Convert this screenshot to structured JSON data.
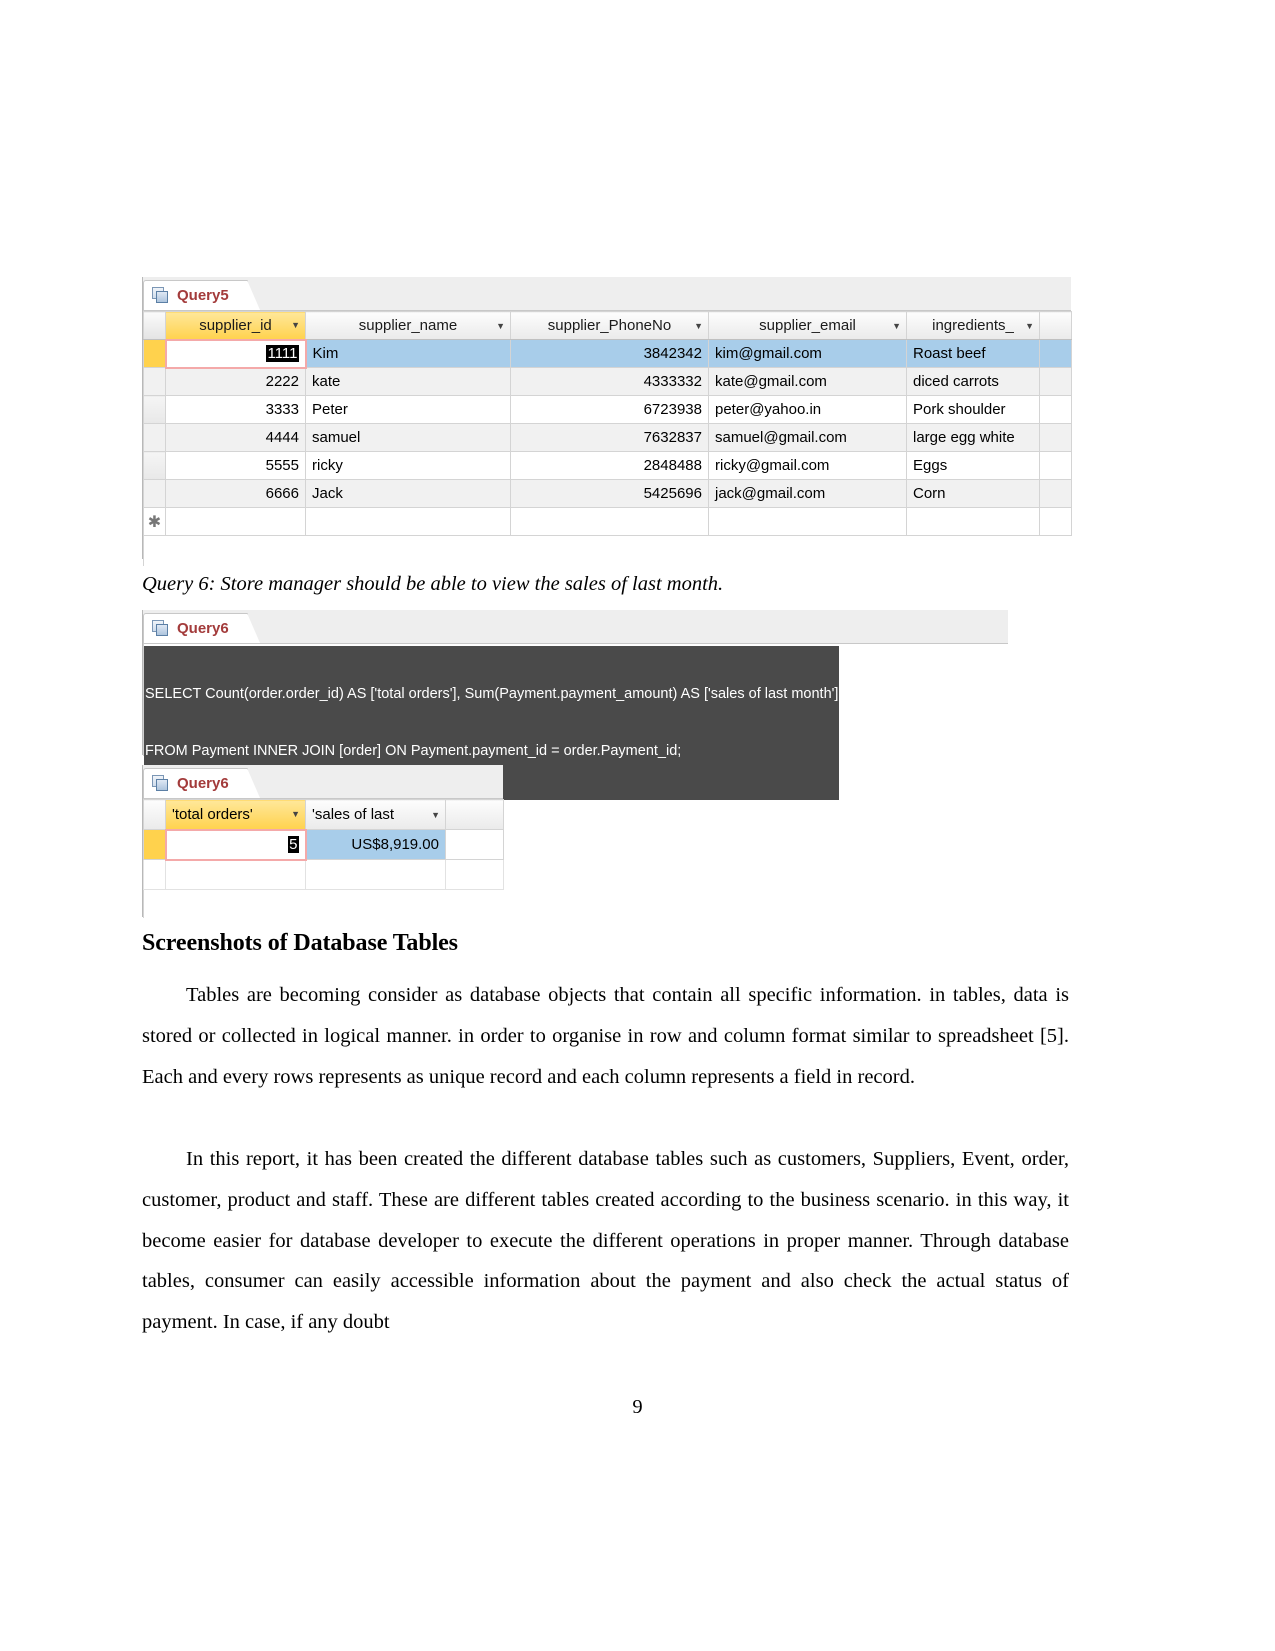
{
  "document": {
    "page_number": "9",
    "heading": "Screenshots of Database Tables",
    "caption_query6": "Query 6: Store manager should be able to view the sales of last month.",
    "paragraph_1": "Tables are becoming consider as database objects that contain all specific information. in tables, data is stored or collected in logical manner. in order to organise in row and column format similar to spreadsheet [5]. Each and every rows represents as unique record and each column represents a field in record.",
    "paragraph_2": "In this report, it has been created the different database tables such as customers, Suppliers, Event, order, customer, product and staff. These are different tables created according to the business scenario. in this way, it become easier for database developer to execute the different operations in proper manner. Through database tables, consumer can easily accessible information about the payment and also check the actual status of payment. In case, if any doubt"
  },
  "query5": {
    "tab_label": "Query5",
    "tab_icon": "datasheet-icon",
    "columns": [
      {
        "label": "supplier_id",
        "selected": true
      },
      {
        "label": "supplier_name",
        "selected": false
      },
      {
        "label": "supplier_PhoneNo",
        "selected": false
      },
      {
        "label": "supplier_email",
        "selected": false
      },
      {
        "label": "ingredients_",
        "selected": false
      }
    ],
    "rows": [
      {
        "supplier_id": "1111",
        "supplier_name": "Kim",
        "supplier_PhoneNo": "3842342",
        "supplier_email": "kim@gmail.com",
        "ingredients": "Roast beef"
      },
      {
        "supplier_id": "2222",
        "supplier_name": "kate",
        "supplier_PhoneNo": "4333332",
        "supplier_email": "kate@gmail.com",
        "ingredients": "diced carrots"
      },
      {
        "supplier_id": "3333",
        "supplier_name": "Peter",
        "supplier_PhoneNo": "6723938",
        "supplier_email": "peter@yahoo.in",
        "ingredients": "Pork shoulder"
      },
      {
        "supplier_id": "4444",
        "supplier_name": "samuel",
        "supplier_PhoneNo": "7632837",
        "supplier_email": "samuel@gmail.com",
        "ingredients": "large egg white"
      },
      {
        "supplier_id": "5555",
        "supplier_name": "ricky",
        "supplier_PhoneNo": "2848488",
        "supplier_email": "ricky@gmail.com",
        "ingredients": "Eggs"
      },
      {
        "supplier_id": "6666",
        "supplier_name": "Jack",
        "supplier_PhoneNo": "5425696",
        "supplier_email": "jack@gmail.com",
        "ingredients": "Corn"
      }
    ],
    "new_record_marker": "✱"
  },
  "query6_sql": {
    "tab_label": "Query6",
    "tab_icon": "datasheet-icon",
    "line_1": "SELECT Count(order.order_id) AS ['total orders'], Sum(Payment.payment_amount) AS ['sales of last month']",
    "line_2": "FROM Payment INNER JOIN [order] ON Payment.payment_id = order.Payment_id;"
  },
  "query6_result": {
    "tab_label": "Query6",
    "tab_icon": "datasheet-icon",
    "columns": [
      {
        "label": "'total orders'",
        "selected": true
      },
      {
        "label": "'sales of last",
        "selected": false
      }
    ],
    "row": {
      "total_orders": "5",
      "sales_of_last_month": "US$8,919.00"
    }
  },
  "colors": {
    "tab_text": "#a33b3b",
    "selected_header": "#ffd24d",
    "selected_row": "#a8cdea",
    "grid_line": "#d4d4d4",
    "sql_background": "#4a4a4a"
  }
}
